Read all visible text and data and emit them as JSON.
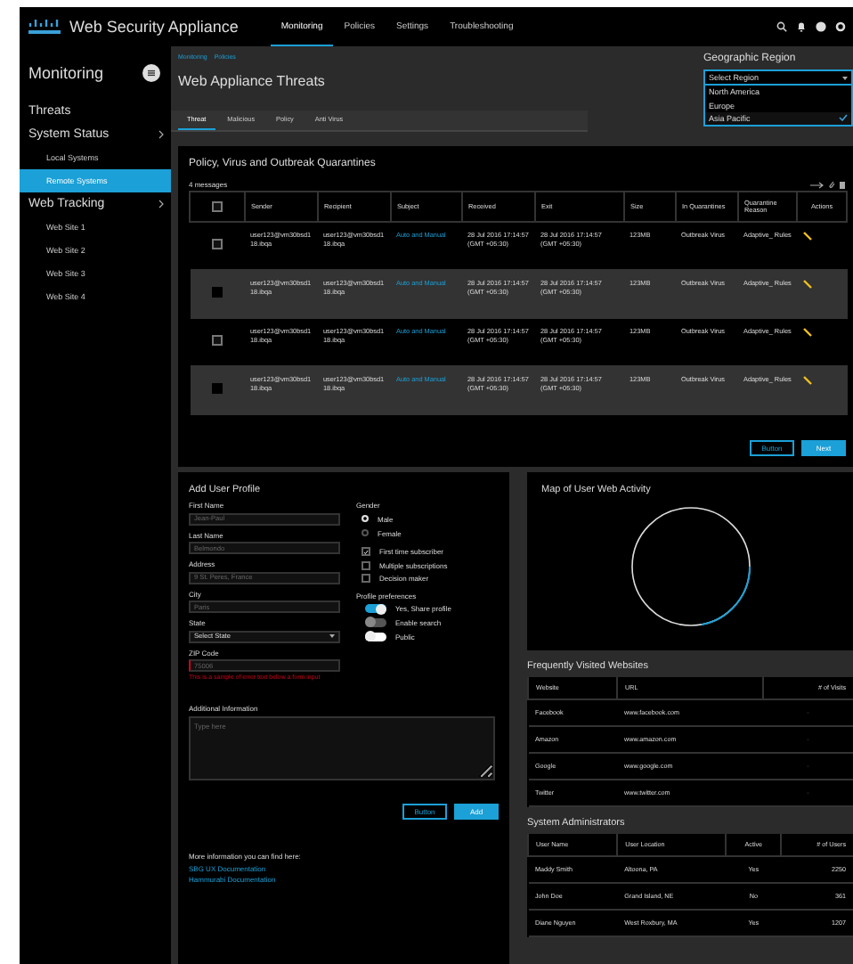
{
  "header": {
    "brand": "Web Security Appliance",
    "nav": [
      {
        "label": "Monitoring",
        "selected": true
      },
      {
        "label": "Policies",
        "selected": false
      },
      {
        "label": "Settings",
        "selected": false
      },
      {
        "label": "Troubleshooting",
        "selected": false
      }
    ]
  },
  "sidebar": {
    "title": "Monitoring",
    "items": [
      {
        "label": "Threats",
        "selected": false
      },
      {
        "label": "System Status",
        "selected": false,
        "children": [
          {
            "label": "Local Systems",
            "selected": false
          },
          {
            "label": "Remote Systems",
            "selected": true
          }
        ]
      },
      {
        "label": "Web Tracking",
        "selected": false,
        "children": [
          {
            "label": "Web Site 1",
            "selected": false
          },
          {
            "label": "Web Site 2",
            "selected": false
          },
          {
            "label": "Web Site 3",
            "selected": false
          },
          {
            "label": "Web Site 4",
            "selected": false
          }
        ]
      }
    ]
  },
  "breadcrumb": [
    "Monitoring",
    "Policies"
  ],
  "page_title": "Web Appliance Threats",
  "tabs": [
    {
      "label": "Threat",
      "selected": true
    },
    {
      "label": "Malicious",
      "selected": false
    },
    {
      "label": "Policy",
      "selected": false
    },
    {
      "label": "Anti Virus",
      "selected": false
    }
  ],
  "region": {
    "label": "Geographic Region",
    "value": "Select Region",
    "options": [
      {
        "label": "North America",
        "selected": false
      },
      {
        "label": "Europe",
        "selected": false
      },
      {
        "label": "Asia Pacific",
        "selected": true
      }
    ]
  },
  "quarantine": {
    "title": "Policy, Virus and Outbreak Quarantines",
    "count": "4 messages",
    "header_checked": false,
    "columns": [
      "Sender",
      "Recipient",
      "Subject",
      "Received",
      "Exit",
      "Size",
      "In Quarantines",
      "Quarantine Reason",
      "Actions"
    ],
    "rows": [
      {
        "checked": false,
        "selected": false,
        "sender": "user123@vm30bsd118.ibqa",
        "recipient": "user123@vm30bsd118.ibqa",
        "subject": "Auto and Manual",
        "received": "28 Jul 2016 17:14:57 (GMT +05:30)",
        "exit": "28 Jul 2016 17:14:57 (GMT +05:30)",
        "size": "123MB",
        "in_quarantines": "Outbreak Virus",
        "reason": "Adaptive_ Rules"
      },
      {
        "checked": true,
        "selected": true,
        "sender": "user123@vm30bsd118.ibqa",
        "recipient": "user123@vm30bsd118.ibqa",
        "subject": "Auto and Manual",
        "received": "28 Jul 2016 17:14:57 (GMT +05:30)",
        "exit": "28 Jul 2016 17:14:57 (GMT +05:30)",
        "size": "123MB",
        "in_quarantines": "Outbreak Virus",
        "reason": "Adaptive_ Rules"
      },
      {
        "checked": false,
        "selected": false,
        "sender": "user123@vm30bsd118.ibqa",
        "recipient": "user123@vm30bsd118.ibqa",
        "subject": "Auto and Manual",
        "received": "28 Jul 2016 17:14:57 (GMT +05:30)",
        "exit": "28 Jul 2016 17:14:57 (GMT +05:30)",
        "size": "123MB",
        "in_quarantines": "Outbreak Virus",
        "reason": "Adaptive_ Rules"
      },
      {
        "checked": true,
        "selected": true,
        "sender": "user123@vm30bsd118.ibqa",
        "recipient": "user123@vm30bsd118.ibqa",
        "subject": "Auto and Manual",
        "received": "28 Jul 2016 17:14:57 (GMT +05:30)",
        "exit": "28 Jul 2016 17:14:57 (GMT +05:30)",
        "size": "123MB",
        "in_quarantines": "Outbreak Virus",
        "reason": "Adaptive_ Rules"
      }
    ],
    "buttons": [
      "Button",
      "Next"
    ]
  },
  "form": {
    "title": "Add User Profile",
    "fields": [
      {
        "label": "First Name",
        "kind": "text",
        "placeholder": "Jean-Paul"
      },
      {
        "label": "Last Name",
        "kind": "text",
        "placeholder": "Belmondo"
      },
      {
        "label": "Address",
        "kind": "text",
        "placeholder": "9 St. Peres, France"
      },
      {
        "label": "City",
        "kind": "text",
        "placeholder": "Paris"
      },
      {
        "label": "State",
        "kind": "select",
        "value": "Select State"
      },
      {
        "label": "ZIP Code",
        "kind": "error",
        "placeholder": "75006",
        "error": "This is a sample of error text below a form input"
      }
    ],
    "gender": {
      "label": "Gender",
      "options": [
        {
          "label": "Male",
          "selected": true
        },
        {
          "label": "Female",
          "selected": false
        }
      ]
    },
    "checkboxes": [
      {
        "label": "First time subscriber",
        "checked": true
      },
      {
        "label": "Multiple subscriptions",
        "checked": false
      },
      {
        "label": "Decision maker",
        "checked": false
      }
    ],
    "preferences": {
      "label": "Profile preferences",
      "toggles": [
        {
          "label": "Yes, Share profile",
          "on": true,
          "disabled": false
        },
        {
          "label": "Enable search",
          "on": false,
          "disabled": true
        },
        {
          "label": "Public",
          "on": false,
          "disabled": false
        }
      ]
    },
    "additional": {
      "label": "Additional Information",
      "placeholder": "Type here"
    },
    "buttons": [
      "Button",
      "Add"
    ],
    "more_info": "More information you can find here:",
    "links": [
      "SBG UX Documentation",
      "Hammurabi Documentation"
    ]
  },
  "map": {
    "title": "Map of User Web Activity"
  },
  "websites": {
    "title": "Frequently Visited Websites",
    "columns": [
      "Website",
      "URL",
      "# of Visits"
    ],
    "rows": [
      [
        "Facebook",
        "www.facebook.com",
        "-"
      ],
      [
        "Amazon",
        "www.amazon.com",
        "-"
      ],
      [
        "Google",
        "www.google.com",
        "-"
      ],
      [
        "Twitter",
        "www.twitter.com",
        "-"
      ]
    ]
  },
  "admins": {
    "title": "System Administrators",
    "columns": [
      "User Name",
      "User Location",
      "Active",
      "# of Users"
    ],
    "rows": [
      [
        "Maddy Smith",
        "Altoona, PA",
        "Yes",
        "2250"
      ],
      [
        "John Doe",
        "Grand Island, NE",
        "No",
        "361"
      ],
      [
        "Diane Nguyen",
        "West Roxbury, MA",
        "Yes",
        "1207"
      ]
    ]
  }
}
